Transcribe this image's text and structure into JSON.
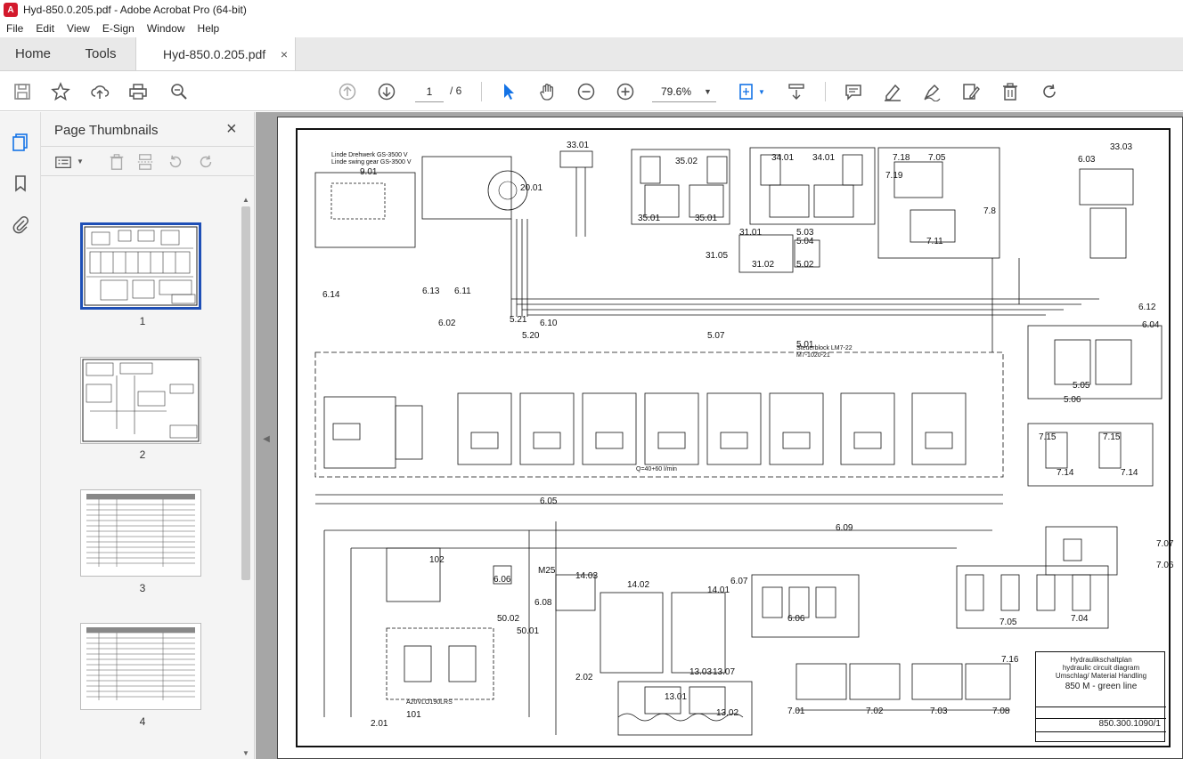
{
  "window": {
    "title": "Hyd-850.0.205.pdf - Adobe Acrobat Pro (64-bit)"
  },
  "menu": [
    "File",
    "Edit",
    "View",
    "E-Sign",
    "Window",
    "Help"
  ],
  "tabs": {
    "home": "Home",
    "tools": "Tools",
    "document": "Hyd-850.0.205.pdf",
    "close": "×"
  },
  "toolbar": {
    "page_current": "1",
    "page_total": "/ 6",
    "zoom": "79.6%"
  },
  "panel": {
    "title": "Page Thumbnails",
    "close": "×",
    "thumbnails": [
      {
        "page": "1",
        "selected": true
      },
      {
        "page": "2",
        "selected": false
      },
      {
        "page": "3",
        "selected": false
      },
      {
        "page": "4",
        "selected": false
      }
    ]
  },
  "drawing": {
    "labels": [
      "9.01",
      "20.01",
      "33.01",
      "35.02",
      "35.01",
      "35.01",
      "34.01",
      "34.01",
      "7.18",
      "7.05",
      "6.03",
      "33.03",
      "7.19",
      "7.8",
      "7.11",
      "31.01",
      "5.03",
      "5.04",
      "31.05",
      "31.02",
      "5.02",
      "6.13",
      "6.11",
      "6.14",
      "6.02",
      "5.21",
      "6.10",
      "5.20",
      "5.07",
      "5.01",
      "6.12",
      "6.04",
      "5.05",
      "5.06",
      "6.05",
      "6.09",
      "7.15",
      "7.14",
      "7.15",
      "7.14",
      "102",
      "6.06",
      "M25",
      "14.03",
      "14.02",
      "14.01",
      "6.08",
      "50.02",
      "50.01",
      "6.07",
      "6.06",
      "7.04",
      "7.05",
      "7.07",
      "7.06",
      "2.02",
      "13.01",
      "13.03",
      "13.07",
      "13.02",
      "101",
      "2.01",
      "7.16",
      "7.01",
      "7.02",
      "7.03",
      "7.08"
    ],
    "text": {
      "drehwerk": "Linde Drehwerk GS-3500 V",
      "swing_gear": "Linde swing gear GS-3500 V",
      "steuerblock": "Steuerblock LM7-22",
      "steuerblock_sub": "M7-1020-21",
      "hydraulikschaltplan": "Hydraulikschaltplan",
      "circuit": "hydraulic circuit diagram",
      "umschlag": "Umschlag/ Material Handling",
      "model": "850 M - green line",
      "nr": "850.300.1090/1",
      "a20": "A20VLO190LRS",
      "flow": "Q=40+60 l/min"
    }
  }
}
